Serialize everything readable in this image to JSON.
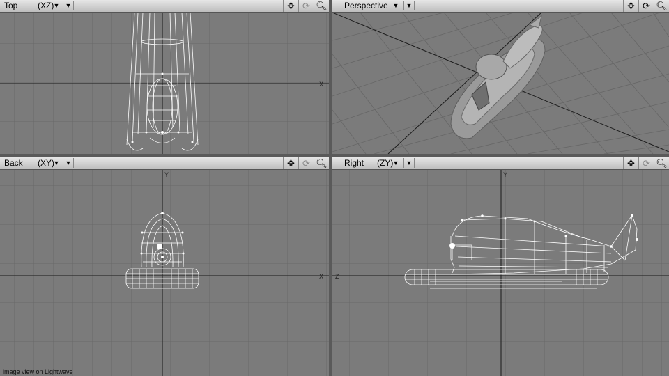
{
  "app": {
    "caption": "image view on Lightwave"
  },
  "viewports": {
    "top": {
      "name": "Top",
      "axis": "(XZ)",
      "axis_label": "X"
    },
    "perspective": {
      "name": "Perspective"
    },
    "back": {
      "name": "Back",
      "axis": "(XY)",
      "axis_label": "X",
      "axis_label_y": "Y"
    },
    "right": {
      "name": "Right",
      "axis": "(ZY)",
      "axis_label": "Z",
      "axis_label_y": "Y"
    }
  },
  "icons": {
    "move": "move-icon",
    "rotate": "rotate-icon",
    "zoom": "zoom-icon",
    "dropdown": "dropdown-arrow-icon"
  },
  "colors": {
    "grid": "#686868",
    "viewport_bg": "#7b7b7b",
    "wire": "#ffffff",
    "axis": "#1a1a1a"
  }
}
